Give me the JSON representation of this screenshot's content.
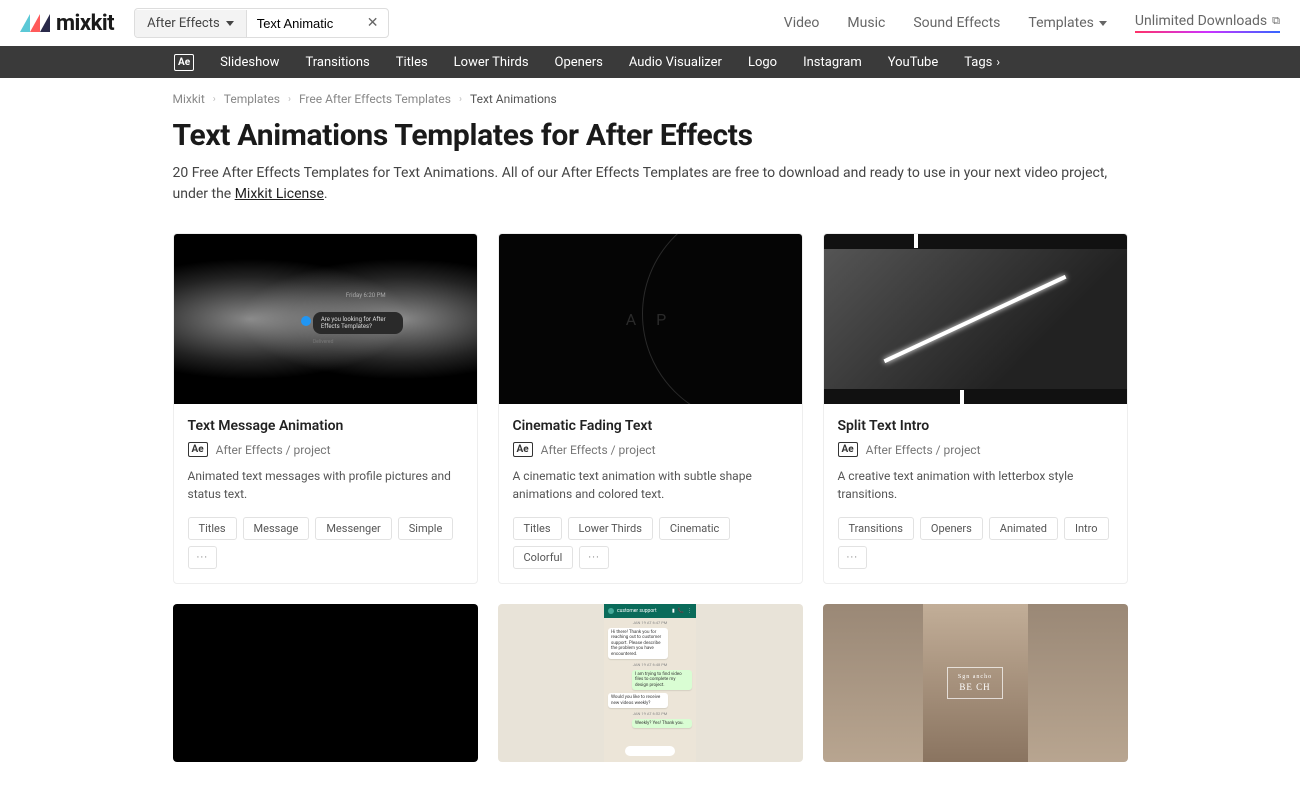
{
  "logo": "mixkit",
  "searchCategory": "After Effects",
  "searchValue": "Text Animatic",
  "topNav": {
    "video": "Video",
    "music": "Music",
    "soundEffects": "Sound Effects",
    "templates": "Templates",
    "unlimited": "Unlimited Downloads"
  },
  "subNav": {
    "aeBadge": "Ae",
    "slideshow": "Slideshow",
    "transitions": "Transitions",
    "titles": "Titles",
    "lowerThirds": "Lower Thirds",
    "openers": "Openers",
    "audioVisualizer": "Audio Visualizer",
    "logo": "Logo",
    "instagram": "Instagram",
    "youtube": "YouTube",
    "tags": "Tags"
  },
  "breadcrumbs": {
    "mixkit": "Mixkit",
    "templates": "Templates",
    "freeAe": "Free After Effects Templates",
    "current": "Text Animations"
  },
  "pageTitle": "Text Animations Templates for After Effects",
  "pageDescPrefix": "20 Free After Effects Templates for Text Animations. All of our After Effects Templates are free to download and ready to use in your next video project, under the ",
  "licenseLink": "Mixkit License",
  "pageDescSuffix": ".",
  "aeMeta": "After Effects / project",
  "aeSmall": "Ae",
  "moreDots": "···",
  "cards": [
    {
      "title": "Text Message Animation",
      "desc": "Animated text messages with profile pictures and status text.",
      "tags": [
        "Titles",
        "Message",
        "Messenger",
        "Simple"
      ]
    },
    {
      "title": "Cinematic Fading Text",
      "desc": "A cinematic text animation with subtle shape animations and colored text.",
      "tags": [
        "Titles",
        "Lower Thirds",
        "Cinematic",
        "Colorful"
      ]
    },
    {
      "title": "Split Text Intro",
      "desc": "A creative text animation with letterbox style transitions.",
      "tags": [
        "Transitions",
        "Openers",
        "Animated",
        "Intro"
      ]
    }
  ],
  "thumb1": {
    "timestamp": "Friday 6:20 PM",
    "bubble": "Are you looking for After Effects Templates?",
    "delivered": "Delivered"
  },
  "thumb2": {
    "txt": "A     P"
  },
  "thumb5": {
    "header": "customer support",
    "date1": "JAN 19 AT 6:47 PM",
    "m1": "Hi there! Thank you for reaching out to customer support. Please describe the problem you have encountered.",
    "m2": "I am trying to find video files to complete my design project.",
    "date2": "JAN 19 AT 6:48 PM",
    "m3": "Would you like to receive new videos weekly?",
    "m4": "Weekly? Yes! Thank you.",
    "date3": "JAN 19 AT 6:52 PM"
  },
  "thumb6": {
    "small": "Sgn ancho",
    "big": "BE   CH"
  }
}
